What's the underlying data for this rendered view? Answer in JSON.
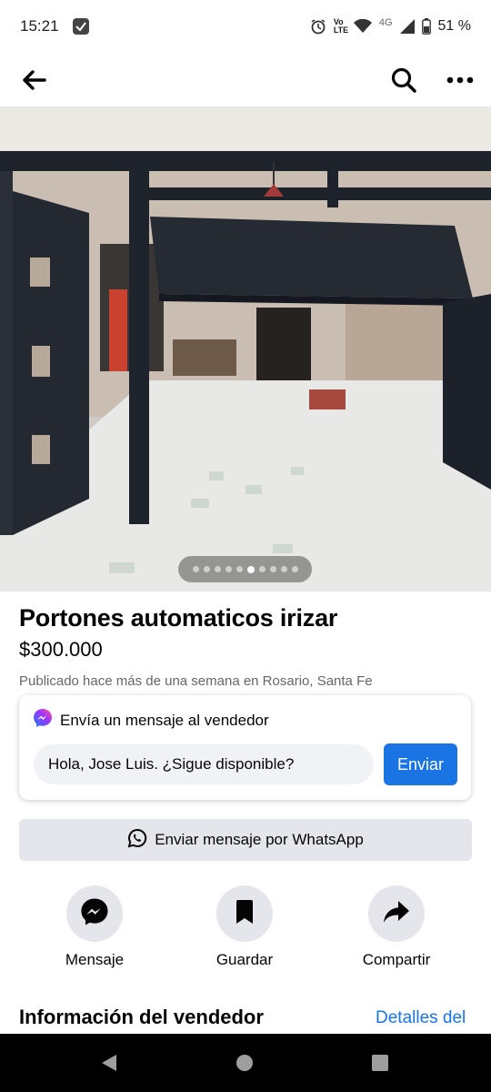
{
  "status_bar": {
    "time": "15:21",
    "volte": "Vo LTE",
    "network": "4G",
    "battery": "51 %"
  },
  "appbar": {
    "back_icon": "arrow-left-icon",
    "search_icon": "search-icon",
    "more_icon": "more-horizontal-icon"
  },
  "gallery": {
    "photo_count": 10,
    "active_index": 5
  },
  "listing": {
    "title": "Portones automaticos irizar",
    "price": "$300.000",
    "posted": "Publicado hace más de una semana en Rosario, Santa Fe"
  },
  "message_card": {
    "heading": "Envía un mensaje al vendedor",
    "input_value": "Hola, Jose Luis. ¿Sigue disponible?",
    "send_label": "Enviar"
  },
  "whatsapp": {
    "label": "Enviar mensaje por WhatsApp"
  },
  "actions": [
    {
      "label": "Mensaje",
      "icon": "messenger-icon"
    },
    {
      "label": "Guardar",
      "icon": "bookmark-icon"
    },
    {
      "label": "Compartir",
      "icon": "share-icon"
    }
  ],
  "seller": {
    "heading": "Información del vendedor",
    "details_link": "Detalles del"
  },
  "colors": {
    "accent": "#1b74e4",
    "button_gray": "#e4e6eb",
    "text": "#050505",
    "secondary_text": "#65676b"
  }
}
